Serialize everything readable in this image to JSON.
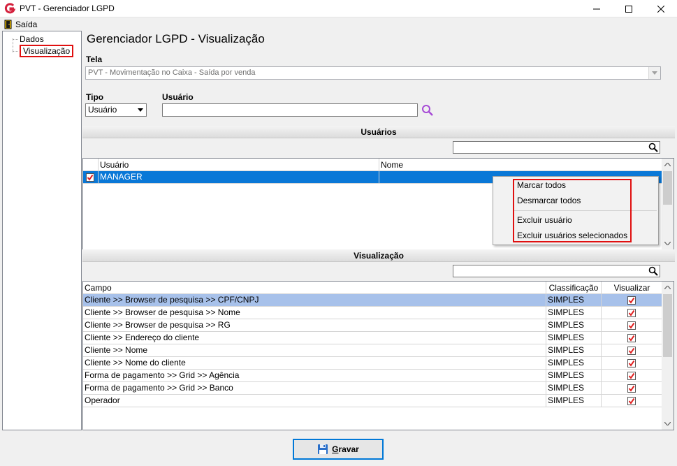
{
  "window": {
    "title": "PVT - Gerenciador LGPD"
  },
  "menu": {
    "saida": "Saída"
  },
  "tree": {
    "items": [
      {
        "label": "Dados"
      },
      {
        "label": "Visualização"
      }
    ]
  },
  "main": {
    "page_title": "Gerenciador LGPD - Visualização",
    "tela_label": "Tela",
    "tela_value": "PVT - Movimentação no Caixa - Saída por venda",
    "tipo_label": "Tipo",
    "tipo_value": "Usuário",
    "usuario_label": "Usuário",
    "usuario_value": ""
  },
  "usuarios_section": {
    "header": "Usuários",
    "columns": [
      "Usuário",
      "Nome"
    ],
    "rows": [
      {
        "usuario": "MANAGER",
        "nome": "",
        "checked": true
      }
    ]
  },
  "context_menu": {
    "items": [
      "Marcar todos",
      "Desmarcar todos",
      "Excluir usuário",
      "Excluir usuários selecionados"
    ]
  },
  "visualizacao_section": {
    "header": "Visualização",
    "columns": [
      "Campo",
      "Classificação",
      "Visualizar"
    ],
    "rows": [
      {
        "campo": "Cliente  >> Browser de pesquisa >> CPF/CNPJ",
        "classificacao": "SIMPLES",
        "visualizar": true
      },
      {
        "campo": "Cliente  >> Browser de pesquisa >> Nome",
        "classificacao": "SIMPLES",
        "visualizar": true
      },
      {
        "campo": "Cliente  >> Browser de pesquisa >> RG",
        "classificacao": "SIMPLES",
        "visualizar": true
      },
      {
        "campo": "Cliente >> Endereço do cliente",
        "classificacao": "SIMPLES",
        "visualizar": true
      },
      {
        "campo": "Cliente >> Nome",
        "classificacao": "SIMPLES",
        "visualizar": true
      },
      {
        "campo": "Cliente >> Nome do cliente",
        "classificacao": "SIMPLES",
        "visualizar": true
      },
      {
        "campo": "Forma de pagamento >> Grid >> Agência",
        "classificacao": "SIMPLES",
        "visualizar": true
      },
      {
        "campo": "Forma de pagamento >> Grid >> Banco",
        "classificacao": "SIMPLES",
        "visualizar": true
      },
      {
        "campo": "Operador",
        "classificacao": "SIMPLES",
        "visualizar": true
      }
    ]
  },
  "footer": {
    "gravar_first": "G",
    "gravar_rest": "ravar"
  },
  "colors": {
    "selection_blue": "#0a78d7",
    "selection_light": "#a7c1ea",
    "highlight_red": "#e01010",
    "check_red": "#e02020"
  }
}
